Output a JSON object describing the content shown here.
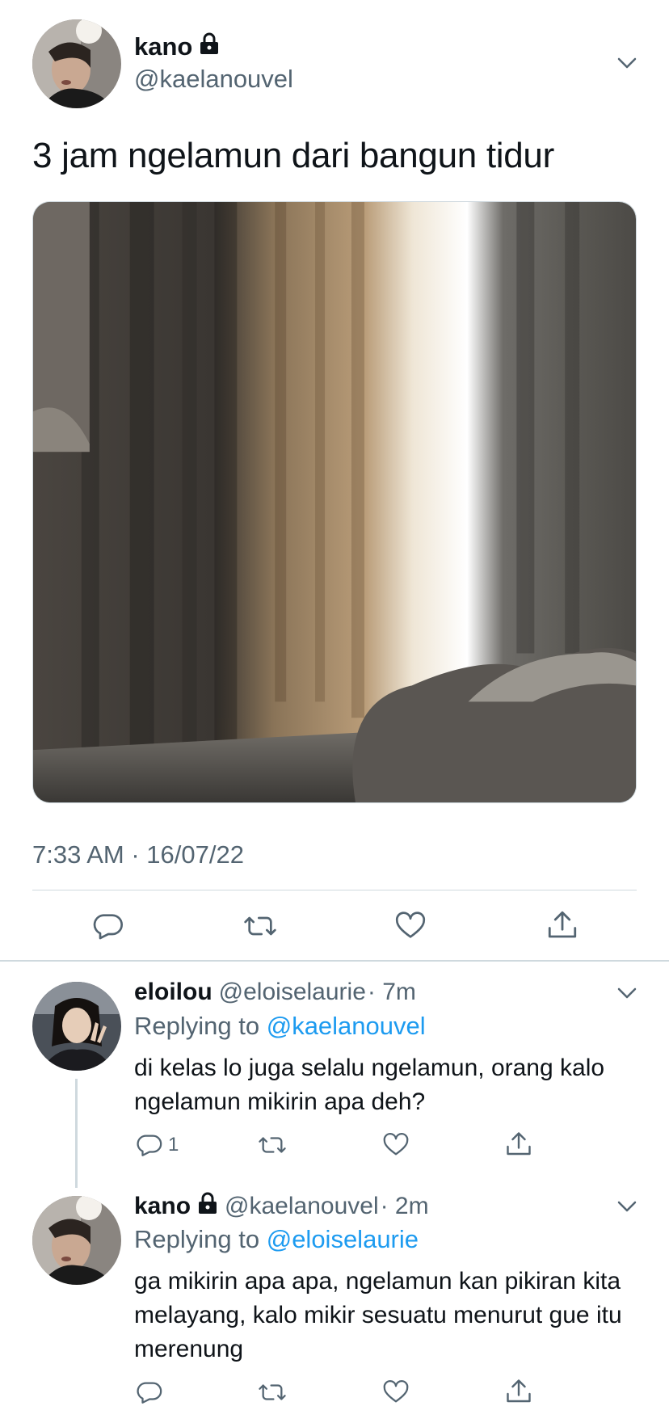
{
  "main_tweet": {
    "name": "kano",
    "handle": "@kaelanouvel",
    "text": "3 jam ngelamun dari bangun tidur",
    "timestamp": "7:33 AM · 16/07/22",
    "icons": [
      "lock-icon",
      "chevron-down-icon",
      "reply-icon",
      "retweet-icon",
      "like-icon",
      "share-icon"
    ]
  },
  "replies": [
    {
      "name": "eloilou",
      "handle": "@eloiselaurie",
      "time": "· 7m",
      "replying_prefix": "Replying to",
      "replying_to": "@kaelanouvel",
      "text": "di kelas lo juga selalu ngelamun, orang kalo ngelamun mikirin apa deh?",
      "reply_count": "1"
    },
    {
      "name": "kano",
      "handle": "@kaelanouvel",
      "time": "· 2m",
      "replying_prefix": "Replying to",
      "replying_to": "@eloiselaurie",
      "text": "ga mikirin apa apa, ngelamun kan pikiran kita melayang, kalo mikir sesuatu menurut gue itu merenung",
      "reply_count": ""
    }
  ],
  "colors": {
    "text": "#0f1419",
    "secondary": "#536471",
    "link": "#1d9bf0",
    "divider": "#cfd9de"
  }
}
